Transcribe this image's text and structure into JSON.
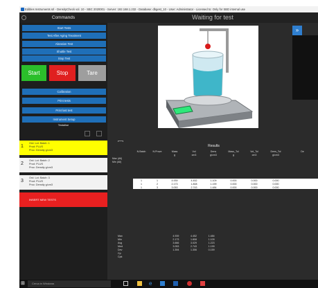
{
  "titlebar": {
    "text": "Edibles Instruments srl - DensityCheck vol. 10 - SBC 2020001 - Server: 192.168.1.232 - Database: dbgest_10 - User: Administrator - Licensed to: Only for SBD internal use"
  },
  "left_header": "Commands",
  "right_header": "Waiting for test",
  "buttons": [
    "Start Tests",
    "Test After Aging Treatment",
    "Abrasion Test",
    "Shuttle Test",
    "Stop Test"
  ],
  "big_buttons": {
    "start": "Start",
    "stop": "Stop",
    "tare": "Tare"
  },
  "buttons2": [
    "Calibration",
    "Print tests",
    "Print last test",
    "Instrument Setup"
  ],
  "section_label": "Testalise",
  "batches": [
    {
      "num": "1",
      "lines": [
        "Ord: Lot: Batch: 1",
        "Prod: PLUS",
        "Proc: Density g/cm3"
      ],
      "color": "#ffff00"
    },
    {
      "num": "2",
      "lines": [
        "Ord: Lot: Batch: 2",
        "Prod: PLUS",
        "Proc: Density g/cm3"
      ],
      "color": "#f2f2f2"
    },
    {
      "num": "3",
      "lines": [
        "Ord: Lot: Batch: 3",
        "Prod: PLUS",
        "Proc: Density g/cm3"
      ],
      "color": "#f2f2f2"
    }
  ],
  "insert_label": "INSERT NEW TESTS",
  "results": {
    "title": "Results",
    "columns": [
      "N.Batch",
      "N.Prove",
      "Mass",
      "Vol",
      "Dens",
      "Mass_Tol",
      "Vol_Tol",
      "Dens_Tol",
      "De"
    ],
    "units": [
      "",
      "",
      "g",
      "cm3",
      "g/cm3",
      "g",
      "cm3",
      "g/cm3",
      ""
    ],
    "row_labels": [
      "Max (All)",
      "Min (All)"
    ],
    "rows": [
      [
        "1",
        "1",
        "4.939",
        "4.452",
        "1.109",
        "0.000",
        "0.000",
        "0.000"
      ],
      [
        "1",
        "2",
        "2.173",
        "1.808",
        "1.199",
        "0.000",
        "0.000",
        "0.000"
      ],
      [
        "1",
        "3",
        "3.053",
        "2.743",
        "1.484",
        "0.000",
        "0.000",
        "0.000"
      ]
    ],
    "stats_labels": [
      "Max",
      "Min",
      "Avg",
      "Med",
      "Dev",
      "Cp",
      "Cpk"
    ],
    "stats": [
      [
        "4.939",
        "4.452",
        "1.484"
      ],
      [
        "2.173",
        "1.808",
        "1.109"
      ],
      [
        "3.666",
        "3.029",
        "1.223"
      ],
      [
        "3.053",
        "2.743",
        "1.199"
      ],
      [
        "1.394",
        "1.306",
        "0.159"
      ],
      [
        "",
        "",
        ""
      ],
      [
        "",
        "",
        ""
      ]
    ]
  },
  "taskbar": {
    "search_placeholder": "Cerca in Windows"
  },
  "colors": {
    "accent": "#1f6fb8",
    "start": "#2bbf2b",
    "stop": "#e02020",
    "tare": "#9e9e9e"
  }
}
